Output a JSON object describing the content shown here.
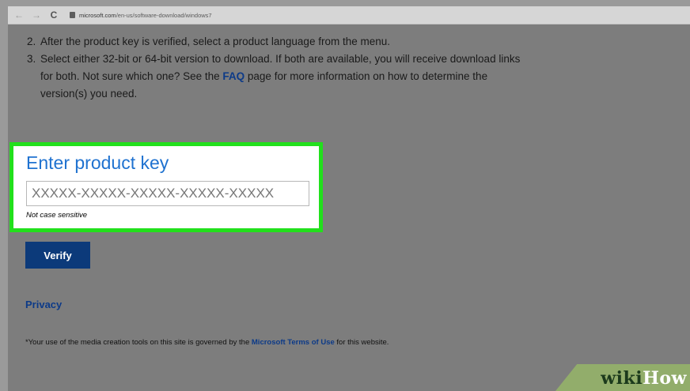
{
  "browser": {
    "back_icon": "arrow-left-icon",
    "forward_icon": "arrow-right-icon",
    "reload_icon": "reload-icon",
    "back_glyph": "←",
    "forward_glyph": "→",
    "reload_glyph": "C",
    "url_domain": "microsoft.com",
    "url_path": "/en-us/software-download/windows7"
  },
  "steps": [
    {
      "num": "2.",
      "text": "After the product key is verified, select a product language from the menu."
    },
    {
      "num": "3.",
      "text_before": "Select either 32-bit or 64-bit version to download. If both are available, you will receive download links for both. Not sure which one? See the ",
      "link": "FAQ",
      "text_after": " page for more information on how to determine the version(s) you need."
    }
  ],
  "product_key": {
    "title": "Enter product key",
    "placeholder": "XXXXX-XXXXX-XXXXX-XXXXX-XXXXX",
    "value": "",
    "hint": "Not case sensitive"
  },
  "verify_label": "Verify",
  "privacy_label": "Privacy",
  "footnote": {
    "before": "*Your use of the media creation tools on this site is governed by the ",
    "link": "Microsoft Terms of Use",
    "after": " for this website."
  },
  "watermark": {
    "part1": "wiki",
    "part2": "How"
  },
  "colors": {
    "highlight": "#22e01c",
    "heading_blue": "#1f72d0",
    "button_navy": "#0c3a7a",
    "link_blue": "#0c3a88"
  }
}
